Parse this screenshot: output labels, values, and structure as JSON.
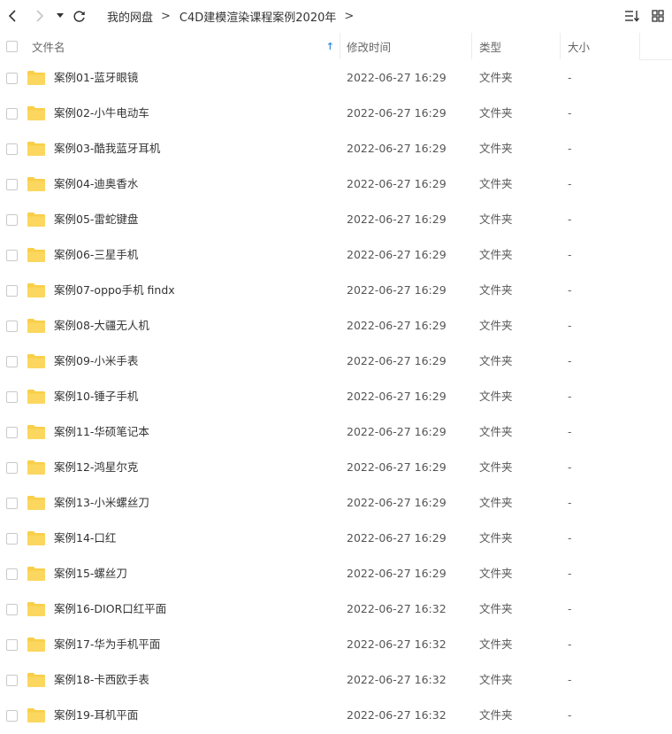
{
  "toolbar": {
    "back_icon": "chevron-left-icon",
    "forward_icon": "chevron-right-icon",
    "history_icon": "caret-down-icon",
    "refresh_icon": "refresh-icon",
    "sort_icon": "sort-list-icon",
    "grid_icon": "grid-view-icon"
  },
  "breadcrumb": {
    "items": [
      "我的网盘",
      "C4D建模渲染课程案例2020年"
    ],
    "separator": ">"
  },
  "table": {
    "columns": {
      "name": "文件名",
      "modified": "修改时间",
      "type": "类型",
      "size": "大小"
    },
    "sort_indicator": "↑",
    "accent_color": "#3b8fe6",
    "folder_color": "#f9cf4a",
    "rows": [
      {
        "name": "案例01-蓝牙眼镜",
        "modified": "2022-06-27 16:29",
        "type": "文件夹",
        "size": "-"
      },
      {
        "name": "案例02-小牛电动车",
        "modified": "2022-06-27 16:29",
        "type": "文件夹",
        "size": "-"
      },
      {
        "name": "案例03-酷我蓝牙耳机",
        "modified": "2022-06-27 16:29",
        "type": "文件夹",
        "size": "-"
      },
      {
        "name": "案例04-迪奥香水",
        "modified": "2022-06-27 16:29",
        "type": "文件夹",
        "size": "-"
      },
      {
        "name": "案例05-雷蛇键盘",
        "modified": "2022-06-27 16:29",
        "type": "文件夹",
        "size": "-"
      },
      {
        "name": "案例06-三星手机",
        "modified": "2022-06-27 16:29",
        "type": "文件夹",
        "size": "-"
      },
      {
        "name": "案例07-oppo手机 findx",
        "modified": "2022-06-27 16:29",
        "type": "文件夹",
        "size": "-"
      },
      {
        "name": "案例08-大疆无人机",
        "modified": "2022-06-27 16:29",
        "type": "文件夹",
        "size": "-"
      },
      {
        "name": "案例09-小米手表",
        "modified": "2022-06-27 16:29",
        "type": "文件夹",
        "size": "-"
      },
      {
        "name": "案例10-锤子手机",
        "modified": "2022-06-27 16:29",
        "type": "文件夹",
        "size": "-"
      },
      {
        "name": "案例11-华硕笔记本",
        "modified": "2022-06-27 16:29",
        "type": "文件夹",
        "size": "-"
      },
      {
        "name": "案例12-鸿星尔克",
        "modified": "2022-06-27 16:29",
        "type": "文件夹",
        "size": "-"
      },
      {
        "name": "案例13-小米螺丝刀",
        "modified": "2022-06-27 16:29",
        "type": "文件夹",
        "size": "-"
      },
      {
        "name": "案例14-口红",
        "modified": "2022-06-27 16:29",
        "type": "文件夹",
        "size": "-"
      },
      {
        "name": "案例15-螺丝刀",
        "modified": "2022-06-27 16:29",
        "type": "文件夹",
        "size": "-"
      },
      {
        "name": "案例16-DIOR口红平面",
        "modified": "2022-06-27 16:32",
        "type": "文件夹",
        "size": "-"
      },
      {
        "name": "案例17-华为手机平面",
        "modified": "2022-06-27 16:32",
        "type": "文件夹",
        "size": "-"
      },
      {
        "name": "案例18-卡西欧手表",
        "modified": "2022-06-27 16:32",
        "type": "文件夹",
        "size": "-"
      },
      {
        "name": "案例19-耳机平面",
        "modified": "2022-06-27 16:32",
        "type": "文件夹",
        "size": "-"
      }
    ]
  }
}
